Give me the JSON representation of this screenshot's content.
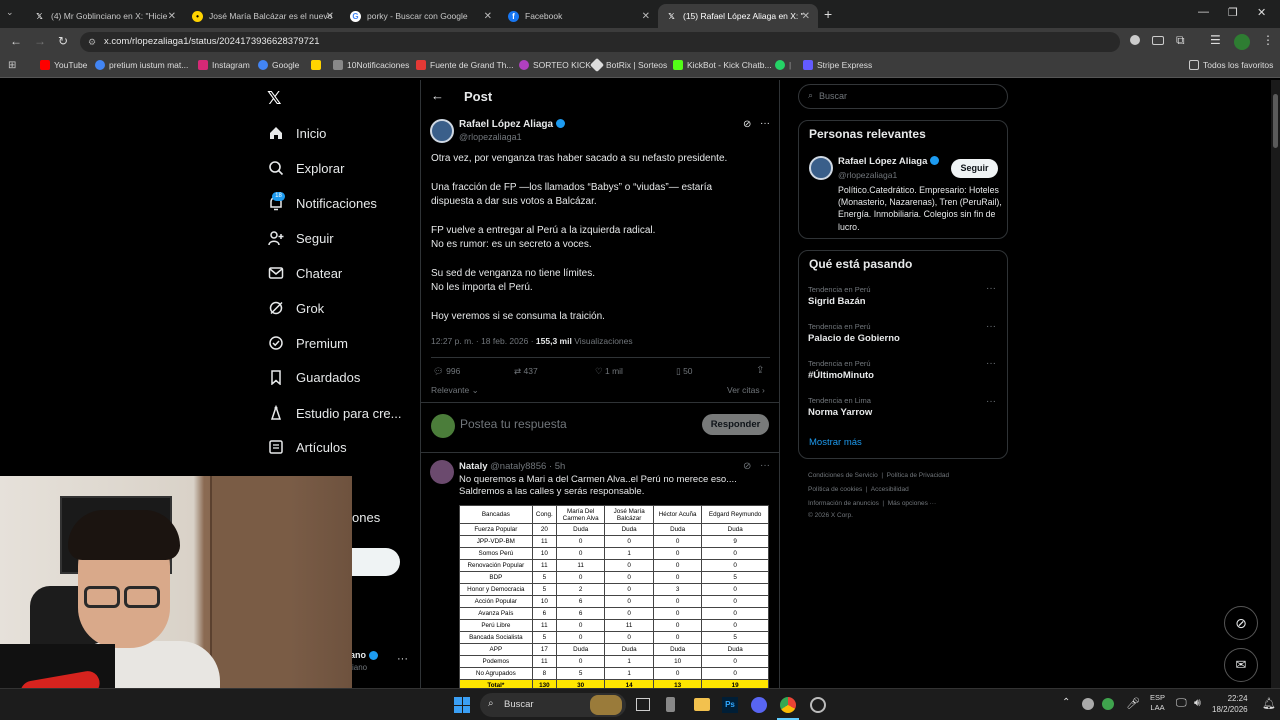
{
  "browser": {
    "tabs": [
      {
        "label": "(4) Mr Goblinciano en X: \"Hicie",
        "icon": "x-logo-icon"
      },
      {
        "label": "José María Balcázar es el nuevo",
        "icon": "news-favicon"
      },
      {
        "label": "porky - Buscar con Google",
        "icon": "google-icon"
      },
      {
        "label": "Facebook",
        "icon": "facebook-icon"
      },
      {
        "label": "(15) Rafael López Aliaga en X: \"",
        "icon": "x-logo-icon"
      }
    ],
    "url": "x.com/rlopezaliaga1/status/2024173936628379721",
    "bookmarks": [
      {
        "label": "YouTube",
        "color": "#ff0000"
      },
      {
        "label": "pretium iustum mat...",
        "color": "#4285f4"
      },
      {
        "label": "Instagram",
        "color": "#d62976"
      },
      {
        "label": "Google",
        "color": "#4285f4"
      },
      {
        "label": "",
        "color": "#ffd400"
      },
      {
        "label": "10Notificaciones",
        "color": "#888888"
      },
      {
        "label": "Fuente de Grand Th...",
        "color": "#e53935"
      },
      {
        "label": "SORTEO KICK",
        "color": "#b040c0"
      },
      {
        "label": "BotRix | Sorteos",
        "color": "#dddddd"
      },
      {
        "label": "KickBot - Kick Chatb...",
        "color": "#53fc18"
      },
      {
        "label": "",
        "color": "#25d366"
      },
      {
        "label": "Stripe Express",
        "color": "#635bff"
      },
      {
        "label": "Todos los favoritos",
        "color": "#cccccc"
      }
    ]
  },
  "sidebar": {
    "items": [
      {
        "label": "Inicio",
        "icon": "home-icon"
      },
      {
        "label": "Explorar",
        "icon": "search-icon"
      },
      {
        "label": "Notificaciones",
        "icon": "bell-icon",
        "badge": "18"
      },
      {
        "label": "Seguir",
        "icon": "follow-icon"
      },
      {
        "label": "Chatear",
        "icon": "mail-icon"
      },
      {
        "label": "Grok",
        "icon": "grok-icon"
      },
      {
        "label": "Premium",
        "icon": "premium-icon"
      },
      {
        "label": "Guardados",
        "icon": "bookmark-icon"
      },
      {
        "label": "Estudio para cre...",
        "icon": "studio-icon"
      },
      {
        "label": "Artículos",
        "icon": "articles-icon"
      }
    ],
    "partial_more": "ones",
    "account_partial": "ano",
    "account_handle_partial": "iano"
  },
  "post": {
    "header": "Post",
    "author": "Rafael López Aliaga",
    "handle": "@rlopezaliaga1",
    "lines": [
      "Otra vez, por venganza tras haber sacado a su nefasto presidente.",
      "Una fracción de FP —los llamados “Babys” o “viudas”— estaría",
      "dispuesta a dar sus votos a Balcázar.",
      "FP vuelve a entregar al Perú a la izquierda radical.",
      "No es rumor: es un secreto a voces.",
      "Su sed de venganza no tiene límites.",
      "No les importa el Perú.",
      "Hoy veremos si se consuma la traición."
    ],
    "meta": "12:27 p. m. · 18 feb. 2026 · ",
    "views": "155,3 mil",
    "views_label": "Visualizaciones",
    "stats": {
      "replies": "996",
      "reposts": "437",
      "likes": "1 mil",
      "bookmarks": "50"
    },
    "relevant": "Relevante",
    "quotes": "Ver citas",
    "reply_placeholder": "Postea tu respuesta",
    "reply_button": "Responder"
  },
  "reply": {
    "author": "Nataly",
    "handle": "@nataly8856 · 5h",
    "text1": "No queremos a Mari a del Carmen Alva..el Perú no merece eso....",
    "text2": "Saldremos a las calles y serás responsable.",
    "table": {
      "headers": [
        "Bancadas",
        "Cong.",
        "María Del Carmen Alva",
        "José María Balcázar",
        "Héctor Acuña",
        "Edgard Reymundo"
      ],
      "rows": [
        [
          "Fuerza Popular",
          "20",
          "Duda",
          "Duda",
          "Duda",
          "Duda"
        ],
        [
          "JPP-VDP-BM",
          "11",
          "0",
          "0",
          "0",
          "9"
        ],
        [
          "Somos Perú",
          "10",
          "0",
          "1",
          "0",
          "0"
        ],
        [
          "Renovación Popular",
          "11",
          "11",
          "0",
          "0",
          "0"
        ],
        [
          "BDP",
          "5",
          "0",
          "0",
          "0",
          "5"
        ],
        [
          "Honor y Democracia",
          "5",
          "2",
          "0",
          "3",
          "0"
        ],
        [
          "Acción Popular",
          "10",
          "6",
          "0",
          "0",
          "0"
        ],
        [
          "Avanza País",
          "6",
          "6",
          "0",
          "0",
          "0"
        ],
        [
          "Perú Libre",
          "11",
          "0",
          "11",
          "0",
          "0"
        ],
        [
          "Bancada Socialista",
          "5",
          "0",
          "0",
          "0",
          "5"
        ],
        [
          "APP",
          "17",
          "Duda",
          "Duda",
          "Duda",
          "Duda"
        ],
        [
          "Podemos",
          "11",
          "0",
          "1",
          "10",
          "0"
        ],
        [
          "No Agrupados",
          "8",
          "5",
          "1",
          "0",
          "0"
        ]
      ],
      "total": [
        "Total*",
        "130",
        "30",
        "14",
        "13",
        "19"
      ]
    }
  },
  "right": {
    "search_placeholder": "Buscar",
    "relevant_title": "Personas relevantes",
    "person_name": "Rafael López Aliaga",
    "person_handle": "@rlopezaliaga1",
    "follow": "Seguir",
    "bio": "Político.Catedrático. Empresario: Hoteles (Monasterio, Nazarenas), Tren (PeruRail), Energía. Inmobiliaria. Colegios sin fin de lucro.",
    "trending_title": "Qué está pasando",
    "trends": [
      {
        "label": "Tendencia en Perú",
        "topic": "Sigrid Bazán"
      },
      {
        "label": "Tendencia en Perú",
        "topic": "Palacio de Gobierno"
      },
      {
        "label": "Tendencia en Perú",
        "topic": "#ÚltimoMinuto"
      },
      {
        "label": "Tendencia en Lima",
        "topic": "Norma Yarrow"
      }
    ],
    "show_more": "Mostrar más",
    "footer1": "Condiciones de Servicio  |  Política de Privacidad",
    "footer2": "Política de cookies  |  Accesibilidad",
    "footer3": "Información de anuncios  |  Más opciones ···",
    "footer4": "© 2026 X Corp."
  },
  "taskbar": {
    "search": "Buscar",
    "lang1": "ESP",
    "lang2": "LAA",
    "time": "22:24",
    "date": "18/2/2026"
  }
}
